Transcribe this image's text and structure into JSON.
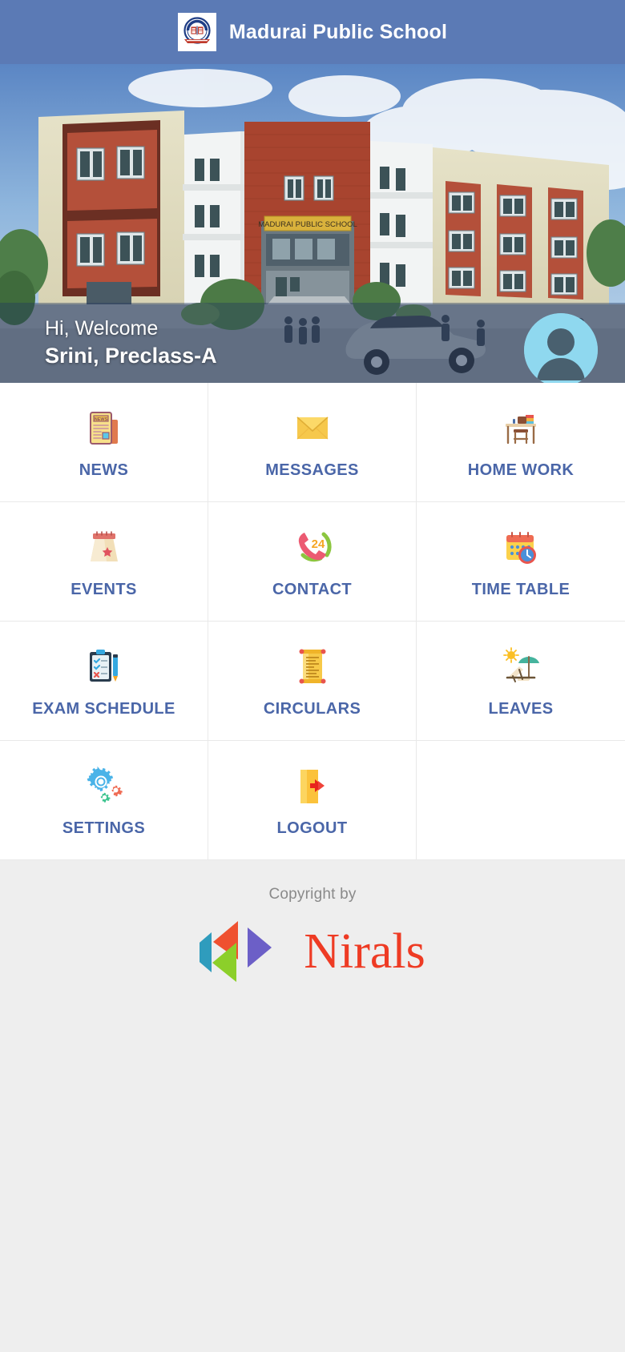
{
  "header": {
    "title": "Madurai Public School",
    "logo_alt": "school-crest"
  },
  "banner": {
    "building_sign": "MADURAI PUBLIC SCHOOL",
    "greeting": "Hi, Welcome",
    "user": "Srini, Preclass-A"
  },
  "menu": {
    "items": [
      {
        "label": "NEWS",
        "icon": "newspaper-icon"
      },
      {
        "label": "MESSAGES",
        "icon": "envelope-icon"
      },
      {
        "label": "HOME WORK",
        "icon": "study-desk-icon"
      },
      {
        "label": "EVENTS",
        "icon": "calendar-star-icon"
      },
      {
        "label": "CONTACT",
        "icon": "phone-24-icon"
      },
      {
        "label": "TIME TABLE",
        "icon": "calendar-clock-icon"
      },
      {
        "label": "EXAM SCHEDULE",
        "icon": "clipboard-pen-icon"
      },
      {
        "label": "CIRCULARS",
        "icon": "scroll-icon"
      },
      {
        "label": "LEAVES",
        "icon": "beach-chair-icon"
      },
      {
        "label": "SETTINGS",
        "icon": "gears-icon"
      },
      {
        "label": "LOGOUT",
        "icon": "exit-door-icon"
      }
    ]
  },
  "footer": {
    "copyright": "Copyright by",
    "brand": "Nirals"
  },
  "colors": {
    "header_bg": "#5b7ab5",
    "label_blue": "#4a66a8",
    "footer_bg": "#eeeeee",
    "brand_red": "#ee3b24",
    "avatar_bg": "#8fd8ef"
  }
}
